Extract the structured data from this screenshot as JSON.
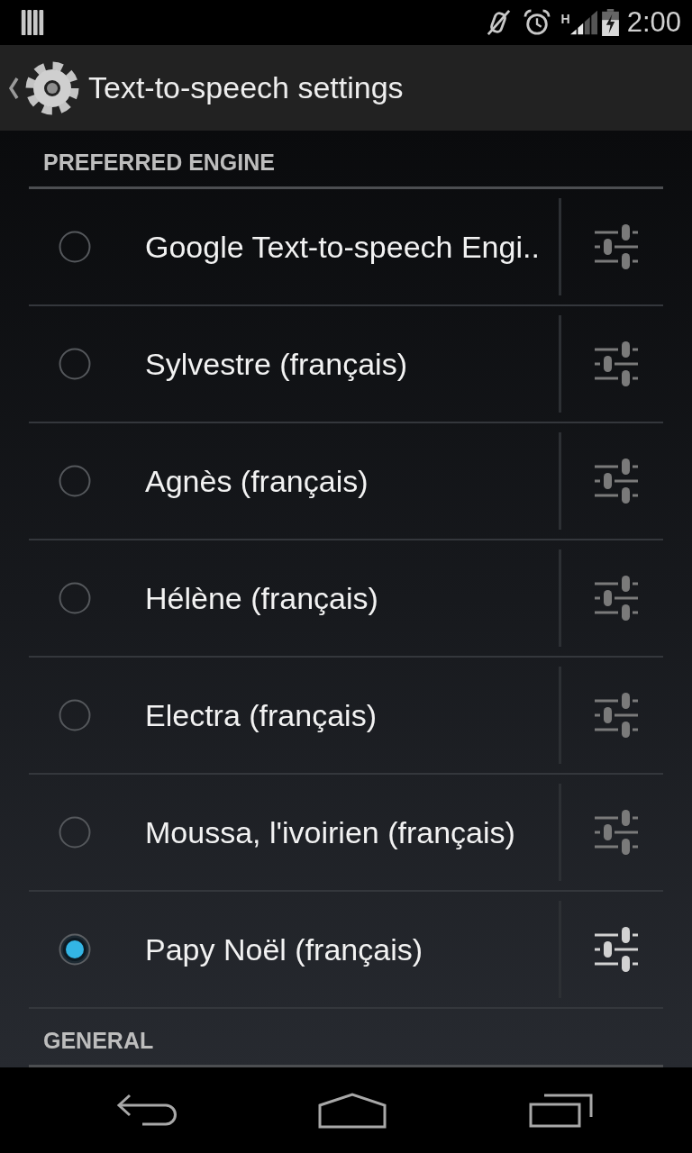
{
  "status_bar": {
    "network_type": "H",
    "time": "2:00"
  },
  "action_bar": {
    "title": "Text-to-speech settings"
  },
  "sections": [
    {
      "header": "PREFERRED ENGINE",
      "engines": [
        {
          "name": "Google Text-to-speech Engi..",
          "selected": false,
          "settings_enabled": false
        },
        {
          "name": "Sylvestre (français)",
          "selected": false,
          "settings_enabled": false
        },
        {
          "name": "Agnès (français)",
          "selected": false,
          "settings_enabled": false
        },
        {
          "name": "Hélène (français)",
          "selected": false,
          "settings_enabled": false
        },
        {
          "name": "Electra (français)",
          "selected": false,
          "settings_enabled": false
        },
        {
          "name": "Moussa, l'ivoirien (français)",
          "selected": false,
          "settings_enabled": false
        },
        {
          "name": "Papy Noël (français)",
          "selected": true,
          "settings_enabled": true
        }
      ]
    },
    {
      "header": "GENERAL"
    }
  ]
}
